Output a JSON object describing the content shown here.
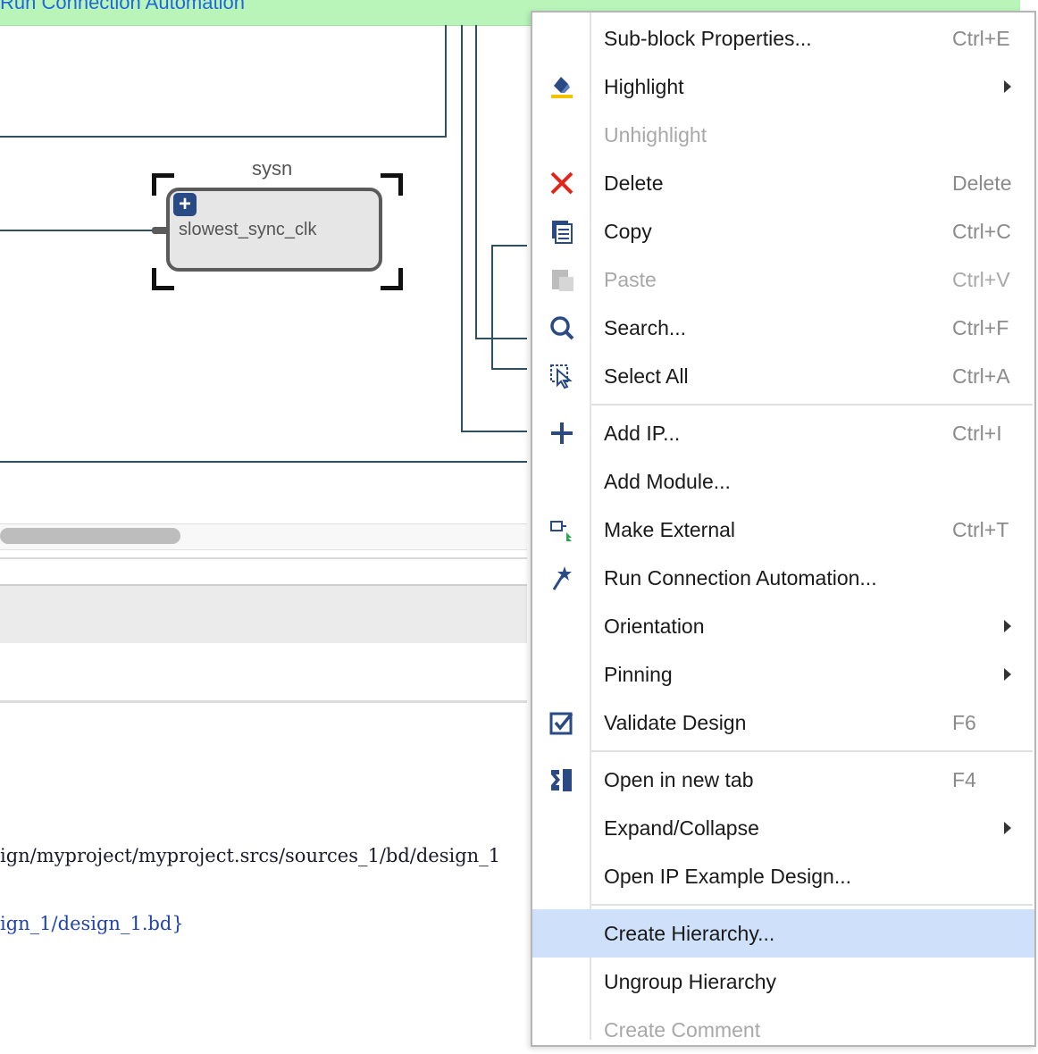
{
  "banner": {
    "text": "Run Connection Automation"
  },
  "block": {
    "title": "sysn",
    "port_label": "slowest_sync_clk"
  },
  "console": {
    "line1": "ign/myproject/myproject.srcs/sources_1/bd/design_1",
    "line2": "ign_1/design_1.bd}"
  },
  "menu": {
    "items": [
      {
        "label": "Sub-block Properties...",
        "shortcut": "Ctrl+E"
      },
      {
        "label": "Highlight",
        "shortcut": ""
      },
      {
        "label": "Unhighlight",
        "shortcut": ""
      },
      {
        "label": "Delete",
        "shortcut": "Delete"
      },
      {
        "label": "Copy",
        "shortcut": "Ctrl+C"
      },
      {
        "label": "Paste",
        "shortcut": "Ctrl+V"
      },
      {
        "label": "Search...",
        "shortcut": "Ctrl+F"
      },
      {
        "label": "Select All",
        "shortcut": "Ctrl+A"
      },
      {
        "label": "Add IP...",
        "shortcut": "Ctrl+I"
      },
      {
        "label": "Add Module...",
        "shortcut": ""
      },
      {
        "label": "Make External",
        "shortcut": "Ctrl+T"
      },
      {
        "label": "Run Connection Automation...",
        "shortcut": ""
      },
      {
        "label": "Orientation",
        "shortcut": ""
      },
      {
        "label": "Pinning",
        "shortcut": ""
      },
      {
        "label": "Validate Design",
        "shortcut": "F6"
      },
      {
        "label": "Open in new tab",
        "shortcut": "F4"
      },
      {
        "label": "Expand/Collapse",
        "shortcut": ""
      },
      {
        "label": "Open IP Example Design...",
        "shortcut": ""
      },
      {
        "label": "Create Hierarchy...",
        "shortcut": ""
      },
      {
        "label": "Ungroup Hierarchy",
        "shortcut": ""
      },
      {
        "label": "Create Comment",
        "shortcut": ""
      }
    ]
  },
  "colors": {
    "banner_bg": "#b9f5b9",
    "highlight_bg": "#cfe0fb",
    "wire": "#2f5061"
  }
}
